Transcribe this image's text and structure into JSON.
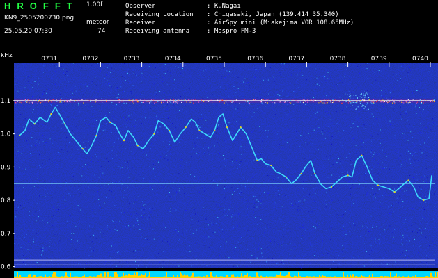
{
  "header": {
    "logo": "HROFFT",
    "version": "1.00f",
    "filename": "KN9_2505200730.png",
    "mode": "meteor",
    "datetime": "25.05.20 07:30",
    "count": "74",
    "info": [
      {
        "label": "Observer",
        "value": ": K.Nagai"
      },
      {
        "label": "Receiving Location",
        "value": ": Chigasaki, Japan (139.414 35.340)"
      },
      {
        "label": "Receiver",
        "value": ": AirSpy mini (Miakejima VOR 108.65MHz)"
      },
      {
        "label": "Receiving antenna",
        "value": ": Maspro FM-3"
      }
    ]
  },
  "colors": {
    "background": "#000000",
    "noise_dark": "#0a0a8a",
    "trace": "#40e0ff",
    "trace_highlight": "#ffd000",
    "axis_text": "#ffffff",
    "logo": "#22ff44",
    "bottom_band": "#00d8ff"
  },
  "chart_data": {
    "type": "heatmap",
    "ylabel": "kHz",
    "yticks": [
      0.6,
      0.7,
      0.8,
      0.9,
      1.0,
      1.1
    ],
    "ylim": [
      0.595,
      1.215
    ],
    "xlim": [
      0,
      600
    ],
    "xticks": [
      {
        "label": "0731",
        "t": 60
      },
      {
        "label": "0732",
        "t": 120
      },
      {
        "label": "0733",
        "t": 180
      },
      {
        "label": "0734",
        "t": 240
      },
      {
        "label": "0735",
        "t": 300
      },
      {
        "label": "0736",
        "t": 360
      },
      {
        "label": "0737",
        "t": 420
      },
      {
        "label": "0738",
        "t": 480
      },
      {
        "label": "0739",
        "t": 540
      },
      {
        "label": "0740",
        "t": 600
      }
    ],
    "hlines": [
      1.1,
      0.85,
      0.62,
      0.605
    ],
    "trace": {
      "t": [
        0,
        8,
        14,
        22,
        30,
        40,
        46,
        52,
        58,
        66,
        74,
        84,
        92,
        98,
        104,
        112,
        118,
        126,
        132,
        140,
        146,
        152,
        158,
        166,
        172,
        180,
        188,
        196,
        202,
        210,
        218,
        226,
        234,
        242,
        250,
        256,
        262,
        270,
        278,
        284,
        290,
        296,
        302,
        310,
        316,
        322,
        330,
        338,
        346,
        352,
        358,
        366,
        374,
        380,
        388,
        396,
        402,
        410,
        416,
        424,
        430,
        438,
        446,
        454,
        462,
        470,
        478,
        484,
        490,
        498,
        506,
        514,
        522,
        530,
        538,
        546,
        552,
        560,
        566,
        574,
        580,
        588,
        596,
        600
      ],
      "f": [
        0.995,
        1.01,
        1.045,
        1.03,
        1.05,
        1.035,
        1.06,
        1.08,
        1.06,
        1.03,
        1.0,
        0.975,
        0.955,
        0.94,
        0.96,
        0.995,
        1.04,
        1.05,
        1.035,
        1.025,
        1.0,
        0.98,
        1.01,
        0.99,
        0.965,
        0.955,
        0.98,
        1.0,
        1.04,
        1.03,
        1.01,
        0.975,
        1.0,
        1.02,
        1.045,
        1.035,
        1.01,
        1.0,
        0.99,
        1.01,
        1.05,
        1.06,
        1.02,
        0.98,
        1.0,
        1.02,
        1.0,
        0.96,
        0.92,
        0.925,
        0.91,
        0.905,
        0.885,
        0.88,
        0.87,
        0.85,
        0.86,
        0.88,
        0.9,
        0.92,
        0.88,
        0.85,
        0.835,
        0.84,
        0.855,
        0.87,
        0.875,
        0.87,
        0.92,
        0.935,
        0.9,
        0.86,
        0.845,
        0.84,
        0.835,
        0.825,
        0.835,
        0.85,
        0.86,
        0.84,
        0.81,
        0.8,
        0.805,
        0.875
      ]
    }
  }
}
